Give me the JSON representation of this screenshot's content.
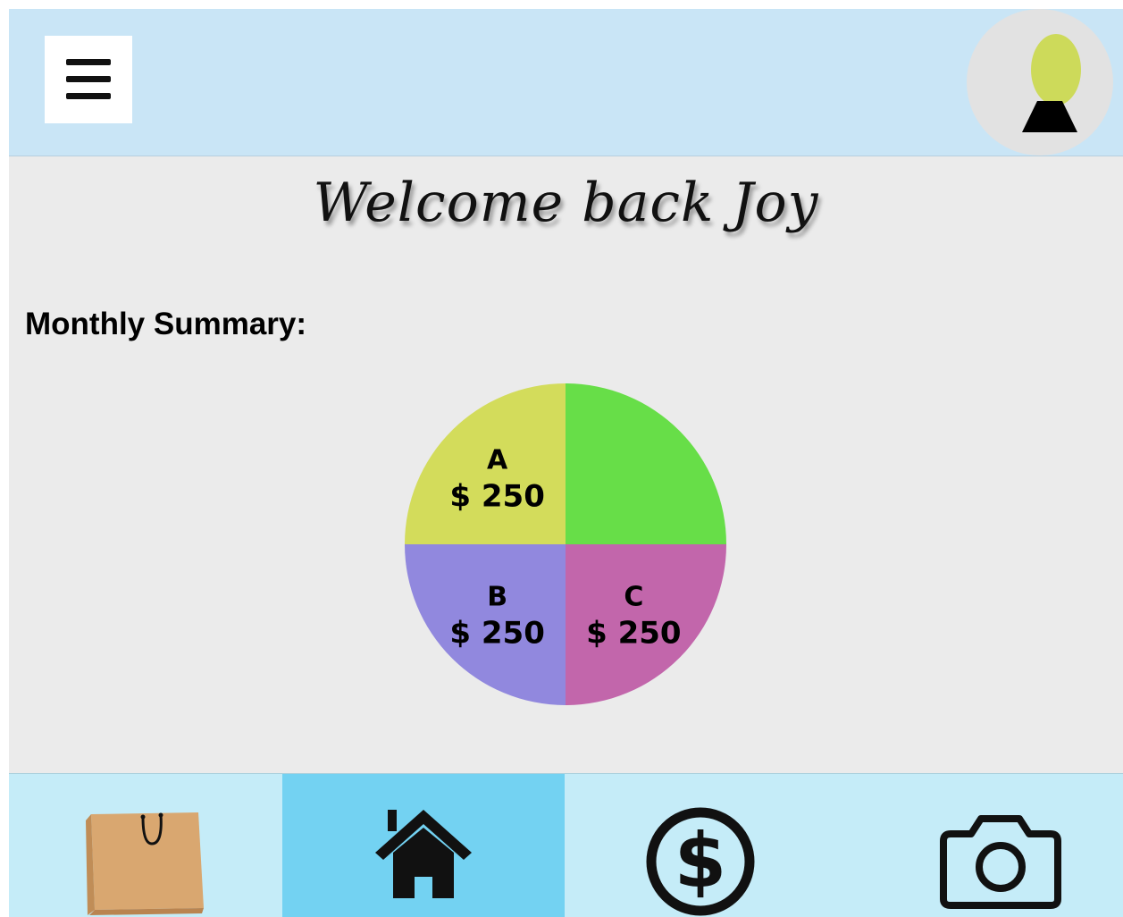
{
  "header": {
    "menu_icon": "hamburger-menu-icon",
    "avatar_icon": "user-avatar-icon"
  },
  "welcome_text": "Welcome  back Joy",
  "summary": {
    "label": "Monthly Summary:"
  },
  "chart_data": {
    "type": "pie",
    "slices": [
      {
        "label": "A",
        "value_label": "$ 250",
        "value": 250,
        "color": "#d3dc5b"
      },
      {
        "label": "",
        "value_label": "",
        "value": 250,
        "color": "#67de48"
      },
      {
        "label": "B",
        "value_label": "$ 250",
        "value": 250,
        "color": "#9188de"
      },
      {
        "label": "C",
        "value_label": "$ 250",
        "value": 250,
        "color": "#c266ab"
      }
    ]
  },
  "bottom_nav": {
    "items": [
      {
        "name": "shopping",
        "icon": "shopping-bag-icon",
        "active": false
      },
      {
        "name": "home",
        "icon": "home-icon",
        "active": true
      },
      {
        "name": "money",
        "icon": "dollar-circle-icon",
        "active": false
      },
      {
        "name": "camera",
        "icon": "camera-icon",
        "active": false
      }
    ]
  },
  "colors": {
    "topbar": "#c9e5f6",
    "background": "#ebebeb",
    "bottombar": "#c5ecf8",
    "active_tab": "#73d2f2",
    "avatar_head": "#cdda5a"
  }
}
